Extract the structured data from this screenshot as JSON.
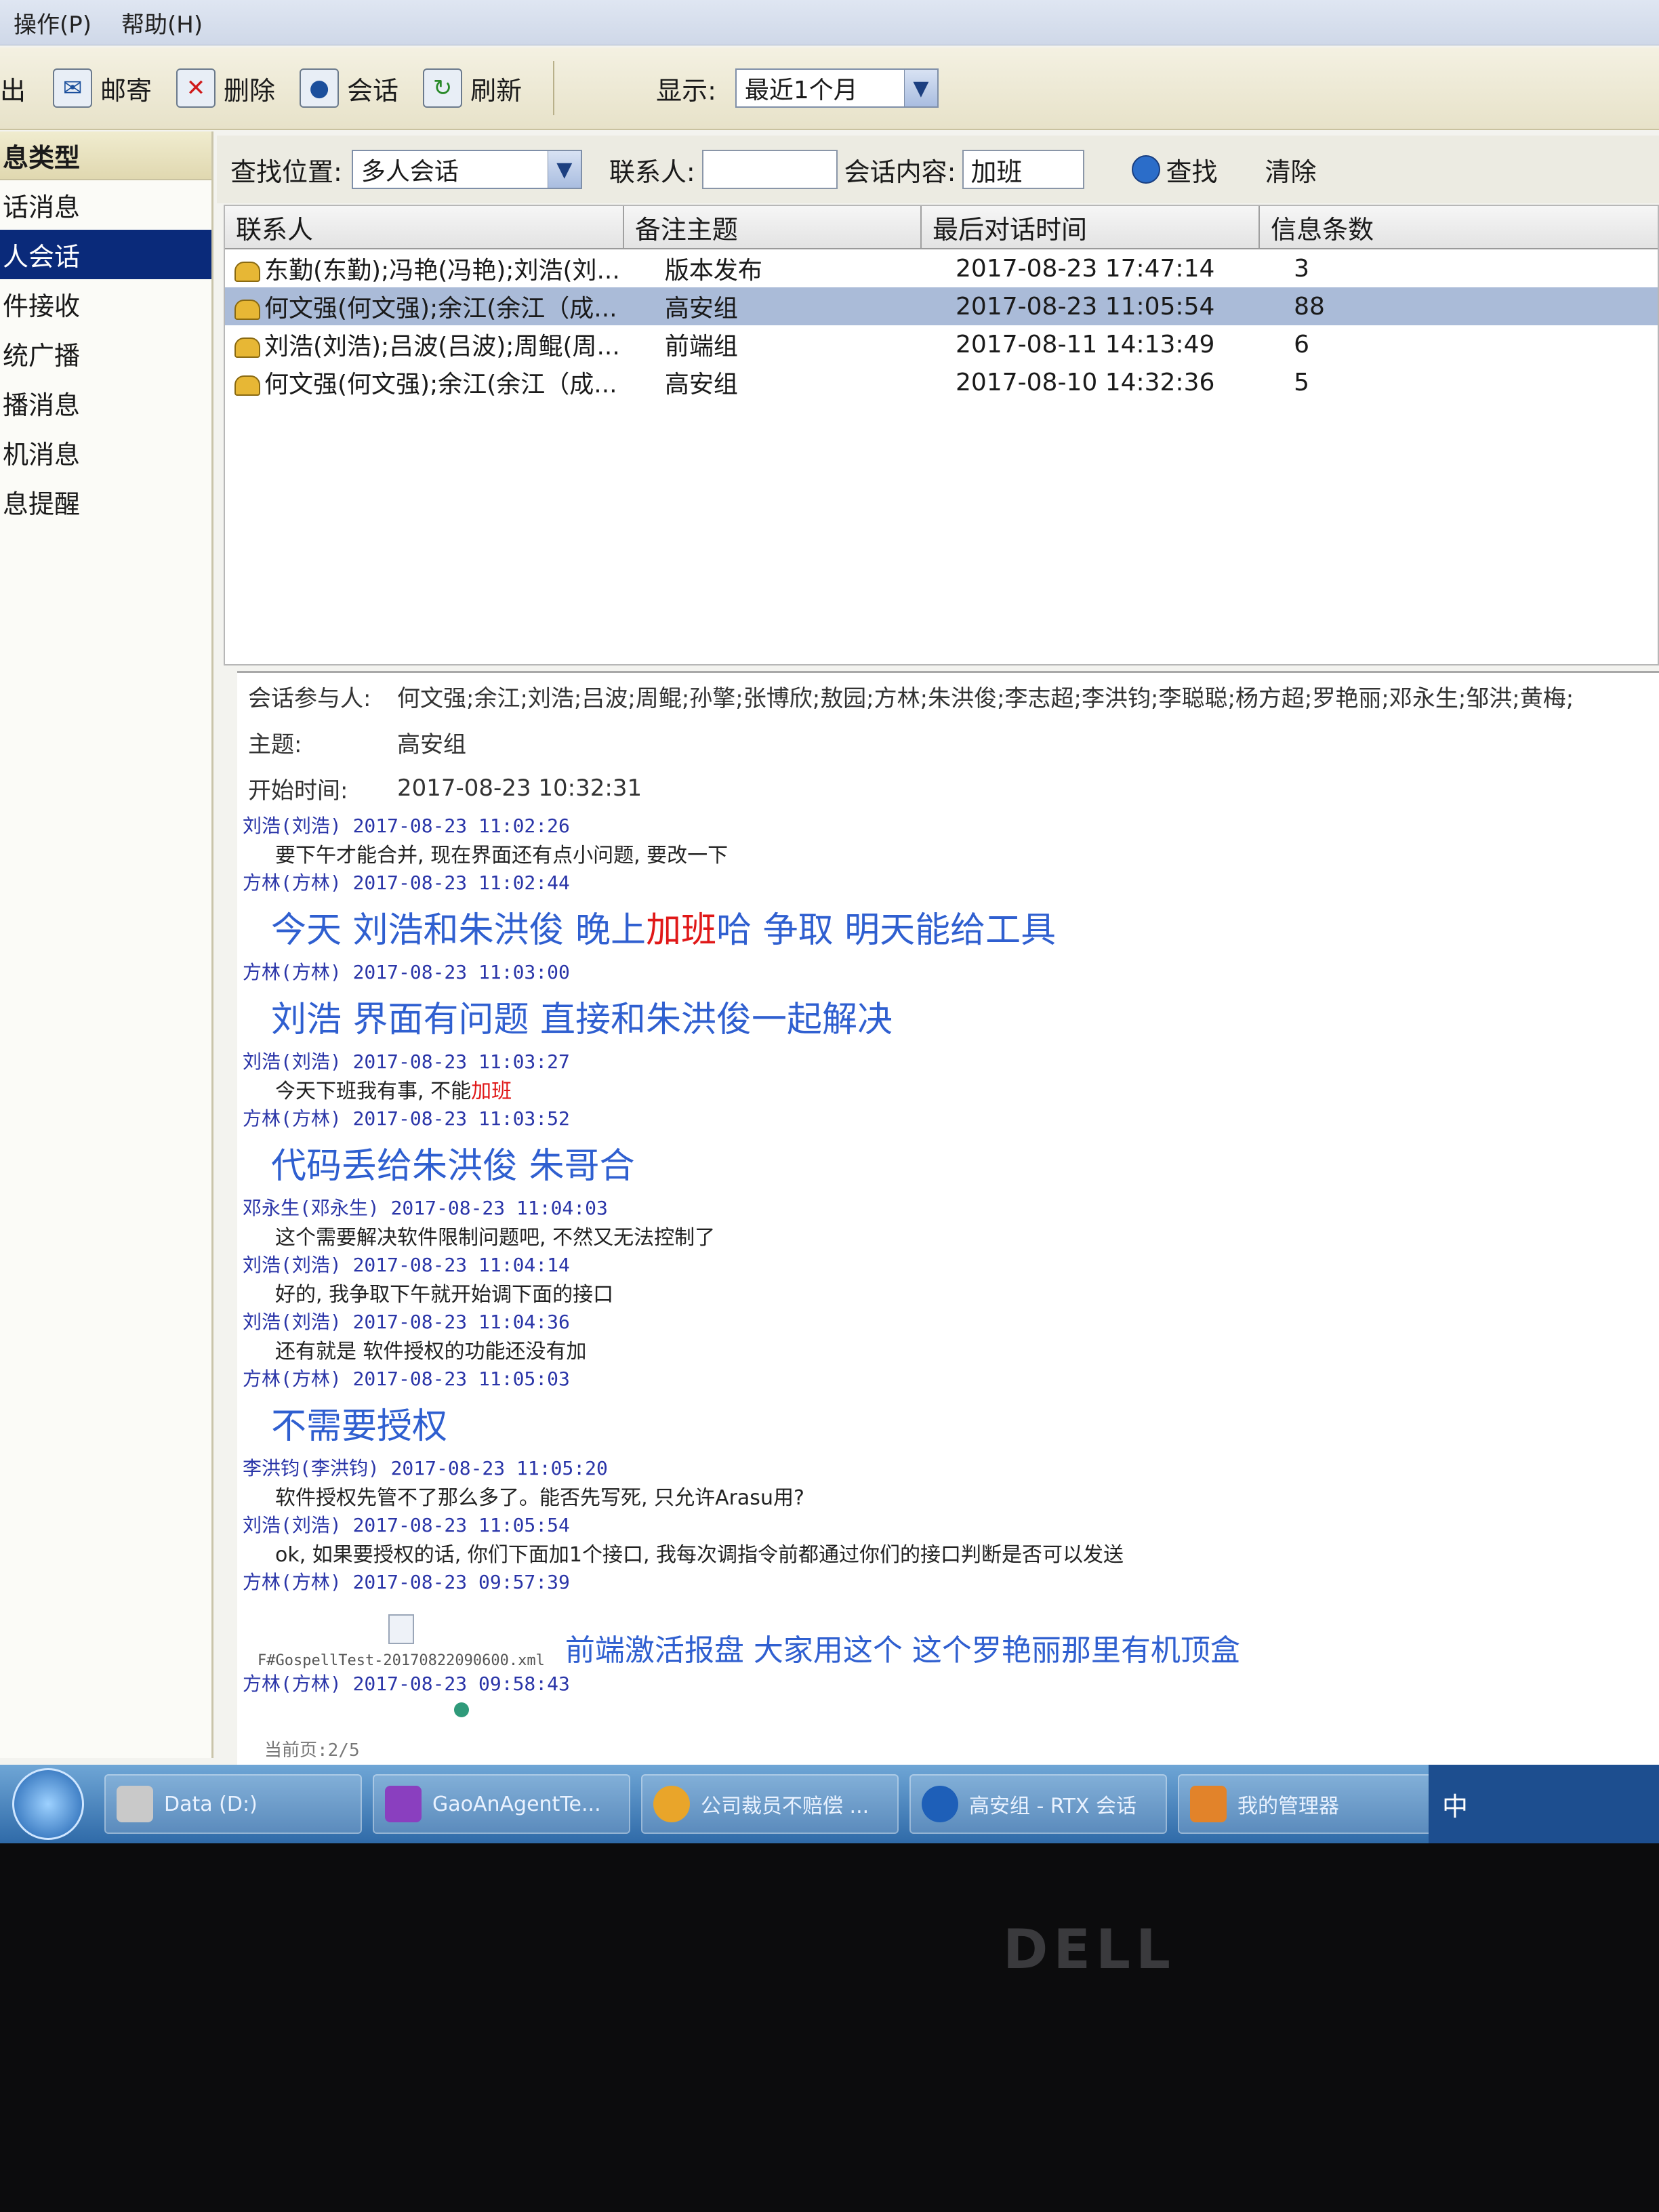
{
  "menu": {
    "items": [
      "操作(P)",
      "帮助(H)"
    ]
  },
  "toolbar": {
    "exit_label": "出",
    "buttons": [
      {
        "label": "邮寄",
        "icon": "mail-icon"
      },
      {
        "label": "删除",
        "icon": "delete-icon"
      },
      {
        "label": "会话",
        "icon": "chat-icon"
      },
      {
        "label": "刷新",
        "icon": "refresh-icon"
      }
    ],
    "display_label": "显示:",
    "display_value": "最近1个月"
  },
  "sidebar": {
    "header": "息类型",
    "items": [
      "话消息",
      "人会话",
      "件接收",
      "统广播",
      "播消息",
      "机消息",
      "息提醒"
    ],
    "selected_index": 1
  },
  "search": {
    "location_label": "查找位置:",
    "location_value": "多人会话",
    "contact_label": "联系人:",
    "contact_value": "",
    "content_label": "会话内容:",
    "content_value": "加班",
    "find_label": "查找",
    "clear_label": "清除"
  },
  "table": {
    "headers": [
      "联系人",
      "备注主题",
      "最后对话时间",
      "信息条数"
    ],
    "rows": [
      {
        "contact": "东勤(东勤);冯艳(冯艳);刘浩(刘...",
        "topic": "版本发布",
        "time": "2017-08-23 17:47:14",
        "count": "3"
      },
      {
        "contact": "何文强(何文强);余江(余江（成...",
        "topic": "高安组",
        "time": "2017-08-23 11:05:54",
        "count": "88"
      },
      {
        "contact": "刘浩(刘浩);吕波(吕波);周鲲(周...",
        "topic": "前端组",
        "time": "2017-08-11 14:13:49",
        "count": "6"
      },
      {
        "contact": "何文强(何文强);余江(余江（成...",
        "topic": "高安组",
        "time": "2017-08-10 14:32:36",
        "count": "5"
      }
    ],
    "selected_index": 1
  },
  "session": {
    "participants_label": "会话参与人:",
    "participants_value": "何文强;余江;刘浩;吕波;周鲲;孙擎;张博欣;敖园;方林;朱洪俊;李志超;李洪钧;李聪聪;杨方超;罗艳丽;邓永生;邹洪;黄梅;",
    "topic_label": "主题:",
    "topic_value": "高安组",
    "start_label": "开始时间:",
    "start_value": "2017-08-23 10:32:31"
  },
  "messages": [
    {
      "head": "刘浩(刘浩) 2017-08-23 11:02:26",
      "body": "要下午才能合并, 现在界面还有点小问题, 要改一下",
      "style": "small"
    },
    {
      "head": "方林(方林) 2017-08-23 11:02:44",
      "body_pre": "今天 刘浩和朱洪俊 晚上",
      "body_hl": "加班",
      "body_post": "哈 争取 明天能给工具",
      "style": "big"
    },
    {
      "head": "方林(方林) 2017-08-23 11:03:00",
      "body": "刘浩 界面有问题 直接和朱洪俊一起解决",
      "style": "big"
    },
    {
      "head": "刘浩(刘浩) 2017-08-23 11:03:27",
      "body_pre": "今天下班我有事, 不能",
      "body_hl": "加班",
      "body_post": "",
      "style": "small"
    },
    {
      "head": "方林(方林) 2017-08-23 11:03:52",
      "body": "代码丢给朱洪俊 朱哥合",
      "style": "big"
    },
    {
      "head": "邓永生(邓永生) 2017-08-23 11:04:03",
      "body": "这个需要解决软件限制问题吧, 不然又无法控制了",
      "style": "small"
    },
    {
      "head": "刘浩(刘浩) 2017-08-23 11:04:14",
      "body": "好的, 我争取下午就开始调下面的接口",
      "style": "small"
    },
    {
      "head": "刘浩(刘浩) 2017-08-23 11:04:36",
      "body": "还有就是 软件授权的功能还没有加",
      "style": "small"
    },
    {
      "head": "方林(方林) 2017-08-23 11:05:03",
      "body": "不需要授权",
      "style": "big"
    },
    {
      "head": "李洪钧(李洪钧) 2017-08-23 11:05:20",
      "body": "软件授权先管不了那么多了。能否先写死, 只允许Arasu用?",
      "style": "small"
    },
    {
      "head": "刘浩(刘浩) 2017-08-23 11:05:54",
      "body": "ok, 如果要授权的话, 你们下面加1个接口, 我每次调指令前都通过你们的接口判断是否可以发送",
      "style": "small"
    },
    {
      "head": "方林(方林) 2017-08-23 09:57:39",
      "attachment": "F#GospellTest-20170822090600.xml",
      "body": "前端激活报盘 大家用这个 这个罗艳丽那里有机顶盒",
      "style": "attach"
    },
    {
      "head": "方林(方林) 2017-08-23 09:58:43",
      "body": "",
      "style": "small"
    }
  ],
  "status": {
    "page": "当前页:2/5"
  },
  "taskbar": {
    "tasks": [
      {
        "label": "Data (D:)",
        "color": "#c9c9c9"
      },
      {
        "label": "GaoAnAgentTe...",
        "color": "#8a3fbf"
      },
      {
        "label": "公司裁员不赔偿 ...",
        "color": "#e9a52a"
      },
      {
        "label": "高安组 - RTX 会话",
        "color": "#1e5fb8"
      },
      {
        "label": "我的管理器",
        "color": "#e2832a"
      }
    ],
    "tray": "中"
  },
  "bezel": {
    "brand": "DELL"
  }
}
